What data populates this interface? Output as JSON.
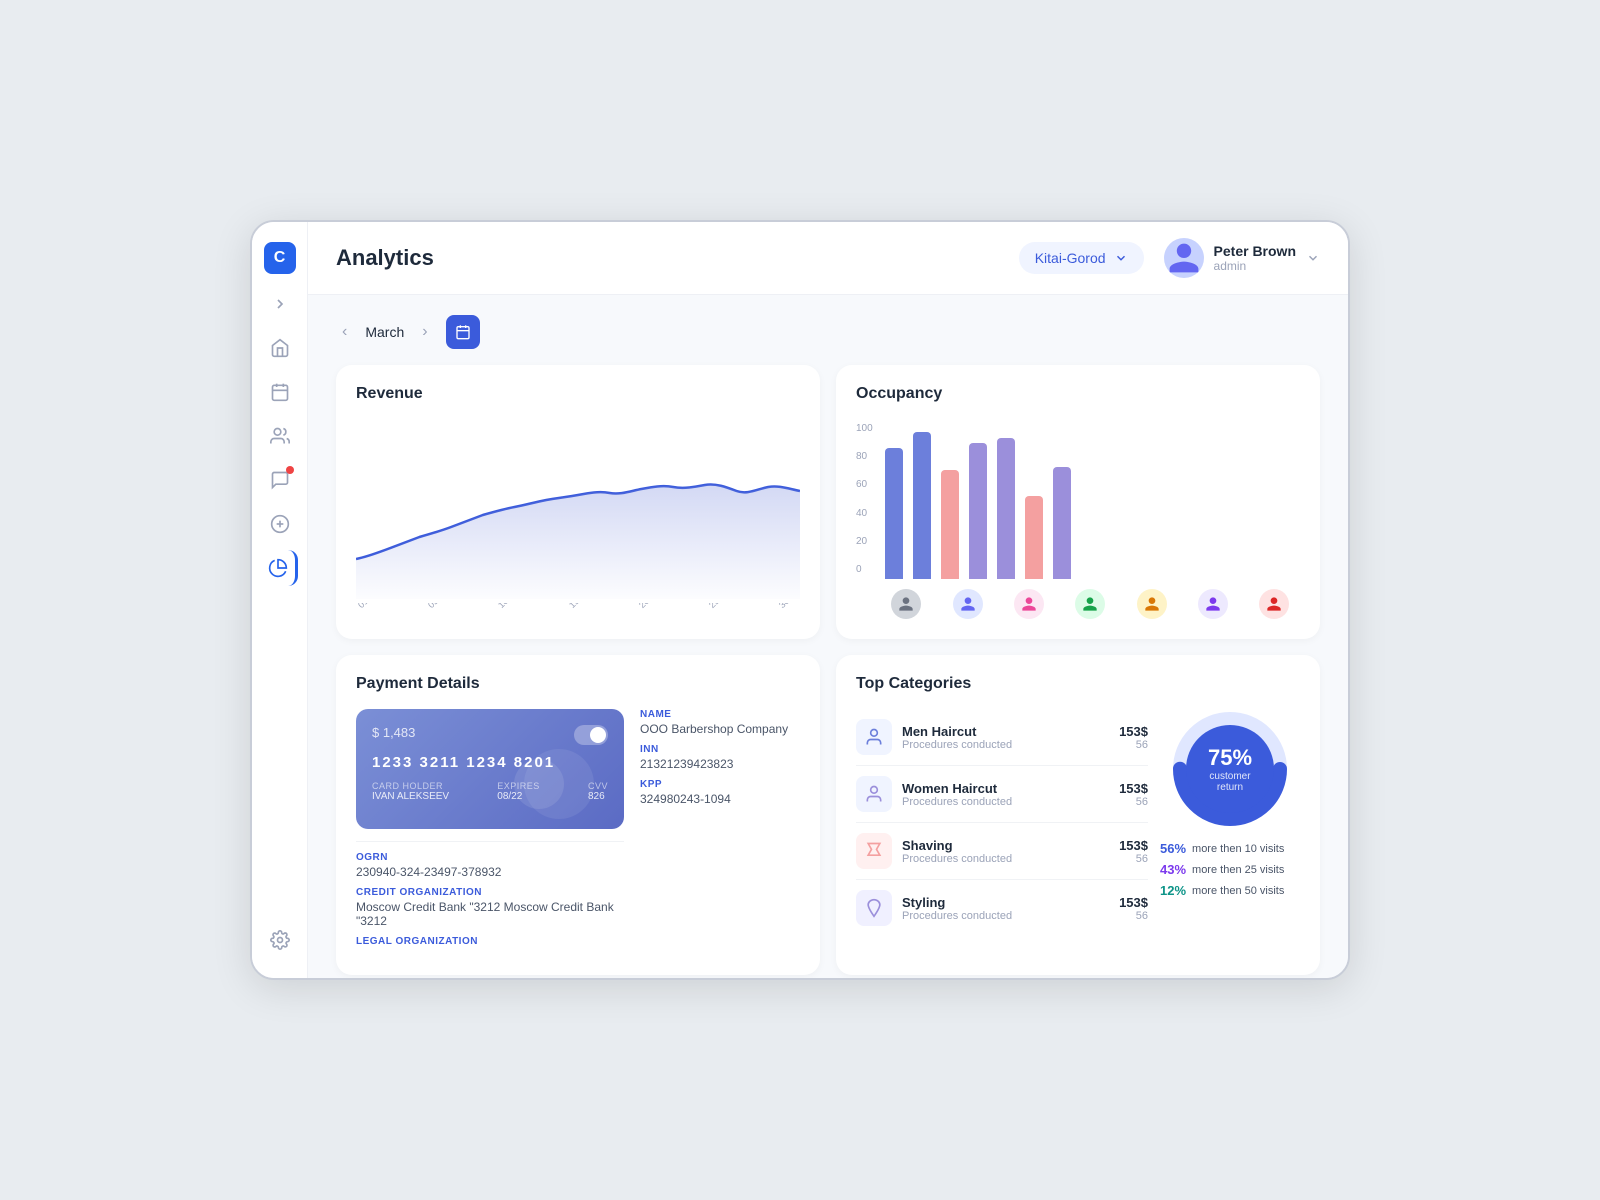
{
  "app": {
    "logo": "C",
    "title": "Analytics"
  },
  "header": {
    "title": "Analytics",
    "location": "Kitai-Gorod",
    "user": {
      "name": "Peter Brown",
      "role": "admin"
    }
  },
  "nav": {
    "month": "March"
  },
  "sidebar": {
    "icons": [
      "home",
      "calendar",
      "users",
      "message",
      "dollar",
      "chart",
      "settings"
    ]
  },
  "revenue": {
    "title": "Revenue",
    "data": [
      20,
      22,
      25,
      28,
      30,
      32,
      35,
      36,
      38,
      40,
      42,
      45,
      43,
      44,
      46,
      47,
      45,
      46,
      48,
      50,
      49,
      47,
      46,
      48,
      50,
      49,
      47,
      50,
      48,
      47
    ]
  },
  "occupancy": {
    "title": "Occupancy",
    "yLabels": [
      "100",
      "80",
      "60",
      "40",
      "20",
      "0"
    ],
    "bars": [
      {
        "blue": 82,
        "pink": 0
      },
      {
        "blue": 92,
        "pink": 0
      },
      {
        "blue": 0,
        "pink": 68
      },
      {
        "blue": 85,
        "pink": 0
      },
      {
        "blue": 88,
        "pink": 0
      },
      {
        "blue": 0,
        "pink": 52
      },
      {
        "blue": 70,
        "pink": 0
      }
    ]
  },
  "payment": {
    "title": "Payment Details",
    "card": {
      "amount": "$ 1,483",
      "number": "1233 3211 1234 8201",
      "holder": "IVAN ALEKSEEV",
      "expires": "08/22",
      "cvv": "826"
    },
    "ogrn": {
      "label": "OGRN",
      "value": "230940-324-23497-378932"
    },
    "creditOrg": {
      "label": "CREDIT ORGANIZATION",
      "value": "Moscow Credit Bank \"3212  Moscow Credit Bank \"3212"
    },
    "legalOrg": {
      "label": "LEGAL ORGANIZATION",
      "value": ""
    },
    "name": {
      "label": "NAME",
      "value": "OOO Barbershop Company"
    },
    "inn": {
      "label": "INN",
      "value": "21321239423823"
    },
    "kpp": {
      "label": "KPP",
      "value": "324980243-1094"
    }
  },
  "categories": {
    "title": "Top Categories",
    "items": [
      {
        "name": "Men Haircut",
        "sub": "Procedures conducted",
        "amount": "153$",
        "count": "56"
      },
      {
        "name": "Women Haircut",
        "sub": "Procedures conducted",
        "amount": "153$",
        "count": "56"
      },
      {
        "name": "Shaving",
        "sub": "Procedures conducted",
        "amount": "153$",
        "count": "56"
      },
      {
        "name": "Styling",
        "sub": "Procedures conducted",
        "amount": "153$",
        "count": "56"
      }
    ],
    "donut": {
      "percent": "75%",
      "label1": "customer",
      "label2": "return"
    },
    "stats": [
      {
        "percent": "56%",
        "desc": "more then 10 visits",
        "color": "blue"
      },
      {
        "percent": "43%",
        "desc": "more then 25 visits",
        "color": "purple"
      },
      {
        "percent": "12%",
        "desc": "more then 50 visits",
        "color": "teal"
      }
    ]
  }
}
